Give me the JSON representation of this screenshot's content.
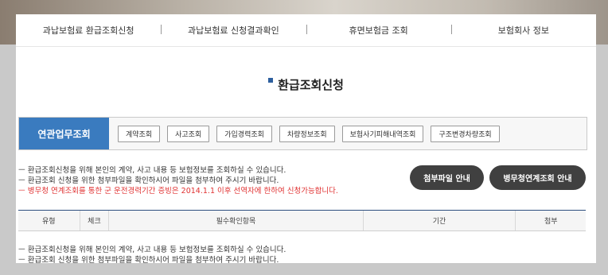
{
  "topnav": {
    "items": [
      "과납보험료 환급조회신청",
      "과납보험료 신청결과확인",
      "휴면보험금 조회",
      "보험회사 정보"
    ]
  },
  "page": {
    "title": "환급조회신청"
  },
  "related": {
    "label": "연관업무조회",
    "buttons": [
      "계약조회",
      "사고조회",
      "가입경력조회",
      "차량정보조회",
      "보험사기피해내역조회",
      "구조변경차량조회"
    ]
  },
  "notice": {
    "lines": [
      "ㅡ 환급조회신청을 위해 본인의 계약, 사고 내용 등 보험정보를 조회하실 수 있습니다.",
      "ㅡ 환급조회 신청을 위한 첨부파일을 확인하시어 파일을 첨부하여 주시기 바랍니다.",
      "ㅡ 병무청 연계조회를 통한 군 운전경력기간 증빙은 2014.1.1 이후 선역자에 한하여 신청가능합니다."
    ]
  },
  "buttons": {
    "attach": "첨부파일 안내",
    "mma": "병무청연계조회 안내"
  },
  "table": {
    "headers": [
      "유형",
      "체크",
      "필수확인항목",
      "기간",
      "첨부"
    ]
  },
  "colors": {
    "accent": "#3a7bbf",
    "dark_button": "#404040",
    "warning": "#e03131"
  }
}
